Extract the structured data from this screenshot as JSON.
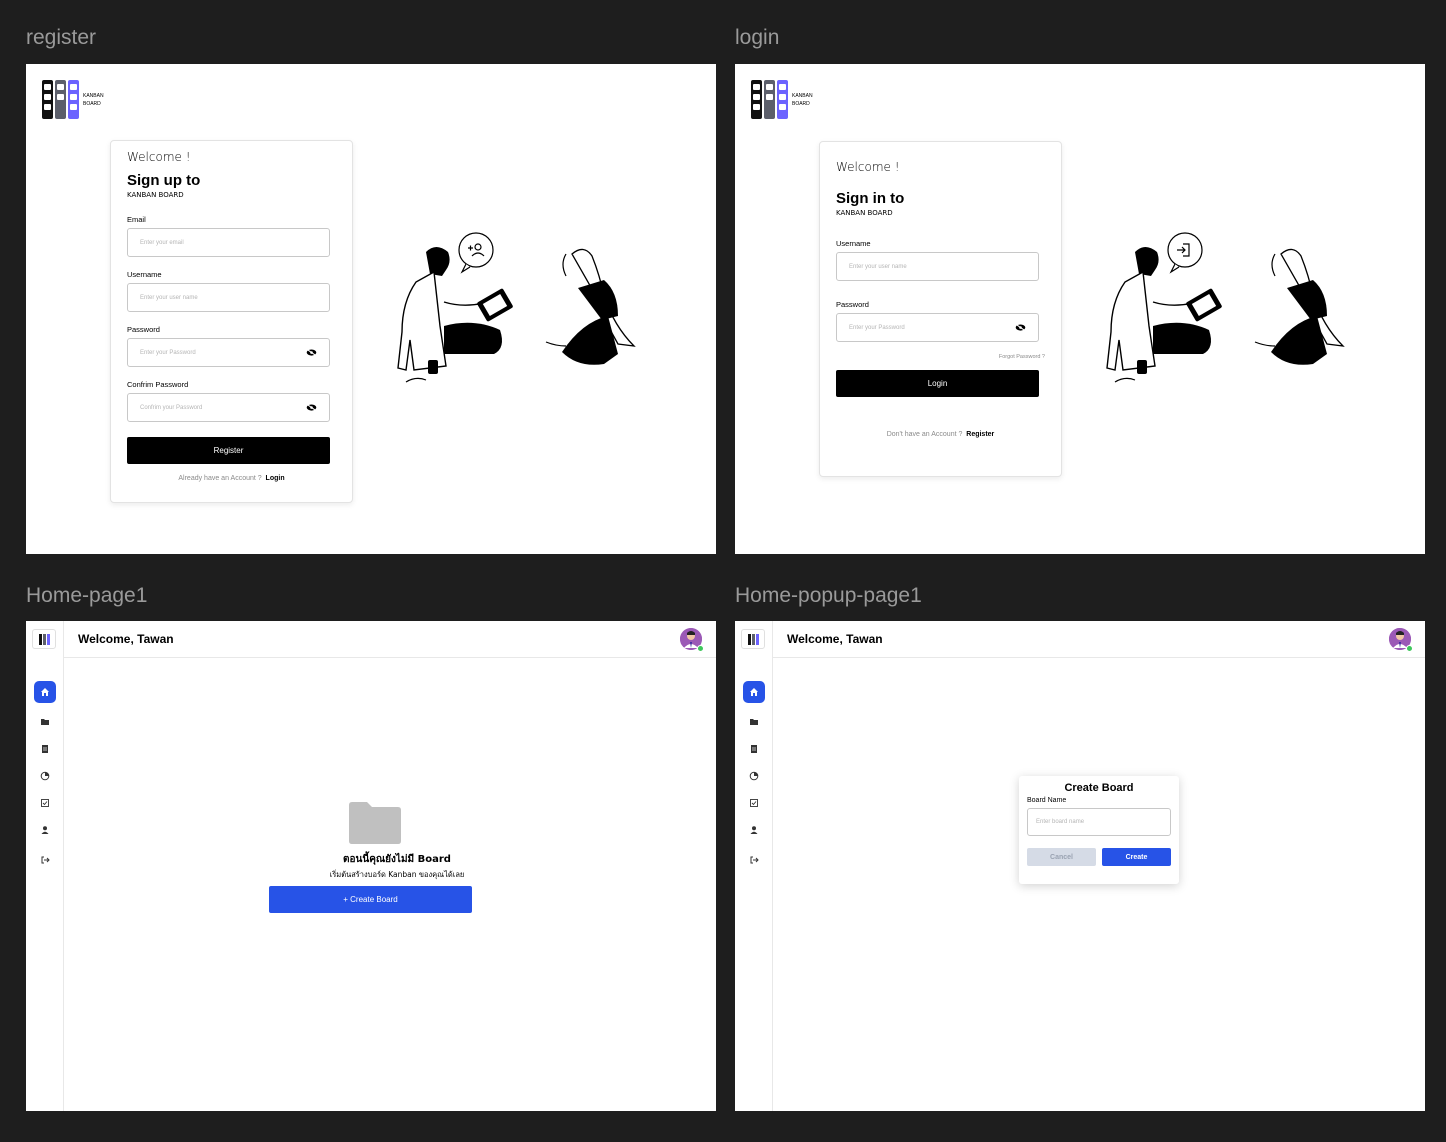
{
  "frames": {
    "register": {
      "label": "register",
      "logo_line1": "KANBAN",
      "logo_line2": "BOARD",
      "welcome": "Welcome !",
      "headline": "Sign up to",
      "subheadline": "KANBAN BOARD",
      "email_label": "Email",
      "email_placeholder": "Enter your email",
      "username_label": "Username",
      "username_placeholder": "Enter your user name",
      "password_label": "Password",
      "password_placeholder": "Enter your Password",
      "confirm_label": "Confrim Password",
      "confirm_placeholder": "Confrim your Password",
      "submit_label": "Register",
      "footer_text": "Already have an Account ?",
      "footer_link": "Login"
    },
    "login": {
      "label": "login",
      "logo_line1": "KANBAN",
      "logo_line2": "BOARD",
      "welcome": "Welcome !",
      "headline": "Sign in to",
      "subheadline": "KANBAN BOARD",
      "username_label": "Username",
      "username_placeholder": "Enter your user name",
      "password_label": "Password",
      "password_placeholder": "Enter your Password",
      "forgot_label": "Forgot Password ?",
      "submit_label": "Login",
      "footer_text": "Don't have an Account ?",
      "footer_link": "Register"
    },
    "home": {
      "label": "Home-page1",
      "header_title": "Welcome, Tawan",
      "empty_title": "ตอนนี้คุณยังไม่มี Board",
      "empty_subtitle": "เริ่มต้นสร้างบอร์ด Kanban ของคุณได้เลย",
      "create_button": "+ Create Board"
    },
    "popup": {
      "label": "Home-popup-page1",
      "header_title": "Welcome, Tawan",
      "modal_title": "Create Board",
      "board_name_label": "Board Name",
      "board_name_placeholder": "Enter board name",
      "cancel_label": "Cancel",
      "create_label": "Create"
    }
  },
  "sidebar_icons": [
    "home-icon",
    "folder-icon",
    "document-icon",
    "pie-chart-icon",
    "checkbox-icon",
    "user-icon",
    "logout-icon"
  ],
  "colors": {
    "canvas": "#1e1e1e",
    "accent_blue": "#2753e7",
    "logo_black": "#111111",
    "logo_gray": "#5c5f6b",
    "logo_purple": "#6c63ff",
    "cancel_bg": "#d5dbe6",
    "online_green": "#3ec75b"
  }
}
